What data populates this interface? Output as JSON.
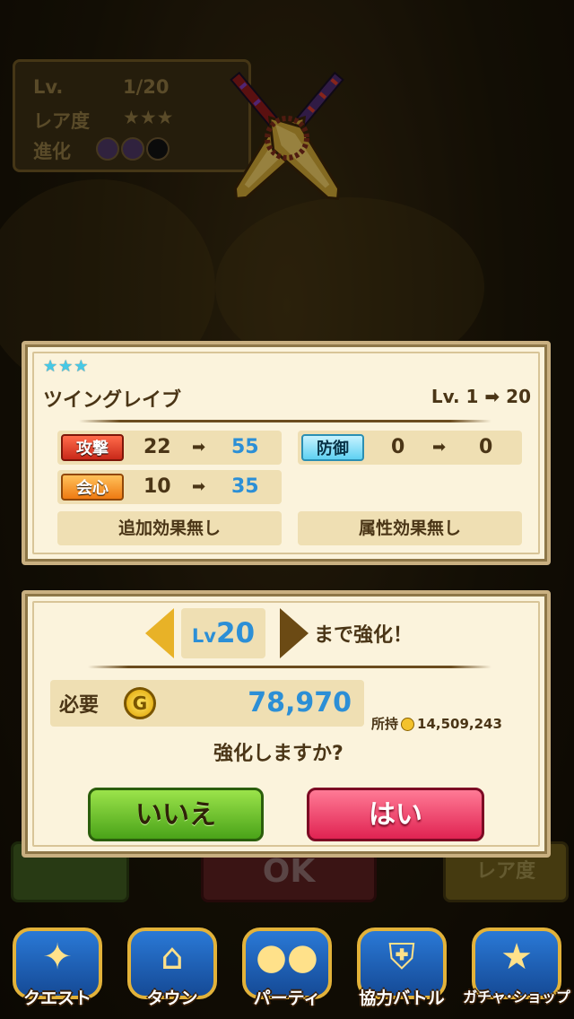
{
  "background": {
    "info_box": {
      "lv_label": "Lv.",
      "lv_value": "1/20",
      "rarity_label": "レア度",
      "rarity_stars": "★★★",
      "evolution_label": "進化"
    },
    "back_buttons": {
      "ok_label": "OK",
      "rarity_label": "レア度"
    }
  },
  "weapon_panel": {
    "stars": "★★★",
    "name": "ツイングレイブ",
    "level_text": "Lv. 1 ➡ 20",
    "stats": {
      "attack": {
        "label": "攻撃",
        "from": "22",
        "arrow": "➡",
        "to": "55"
      },
      "defense": {
        "label": "防御",
        "from": "0",
        "arrow": "➡",
        "to": "0"
      },
      "critical": {
        "label": "会心",
        "from": "10",
        "arrow": "➡",
        "to": "35"
      }
    },
    "effect_left": "追加効果無し",
    "effect_right": "属性効果無し"
  },
  "upgrade_panel": {
    "lv_label": "Lv",
    "lv_value": "20",
    "upto_text": "まで強化！",
    "need_label": "必要",
    "coin_glyph": "G",
    "cost": "78,970",
    "owned_label": "所持",
    "owned_value": "14,509,243",
    "question": "強化しますか?",
    "no_label": "いいえ",
    "yes_label": "はい"
  },
  "nav": [
    {
      "label": "クエスト",
      "icon": "map-icon"
    },
    {
      "label": "タウン",
      "icon": "town-icon"
    },
    {
      "label": "パーティ",
      "icon": "party-icon"
    },
    {
      "label": "協力バトル",
      "icon": "shield-icon"
    },
    {
      "label": "ガチャ･ショップ",
      "icon": "star-icon"
    }
  ],
  "colors": {
    "accent_blue": "#2c8fd6",
    "star_cyan": "#46c9e6",
    "attack_red": "#c9291a",
    "critical_orange": "#ef7a12",
    "defense_blue": "#5fd1f2",
    "yes_red": "#e02352",
    "no_green": "#4aa319"
  }
}
